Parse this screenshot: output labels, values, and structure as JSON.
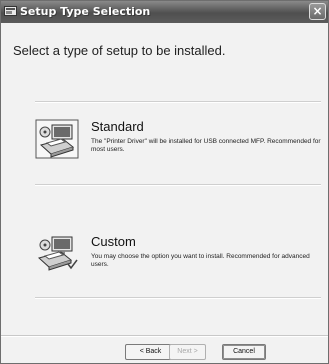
{
  "window": {
    "title": "Setup Type Selection",
    "close_glyph": "×"
  },
  "heading": "Select a type of setup to be installed.",
  "options": [
    {
      "title": "Standard",
      "description": "The \"Printer Driver\" will be installed for USB connected MFP. Recommended for most users.",
      "icon": "printer-setup-standard-icon"
    },
    {
      "title": "Custom",
      "description": "You may choose the option you want to install. Recommended for advanced users.",
      "icon": "printer-setup-custom-icon"
    }
  ],
  "buttons": {
    "back": "< Back",
    "next": "Next >",
    "cancel": "Cancel"
  }
}
